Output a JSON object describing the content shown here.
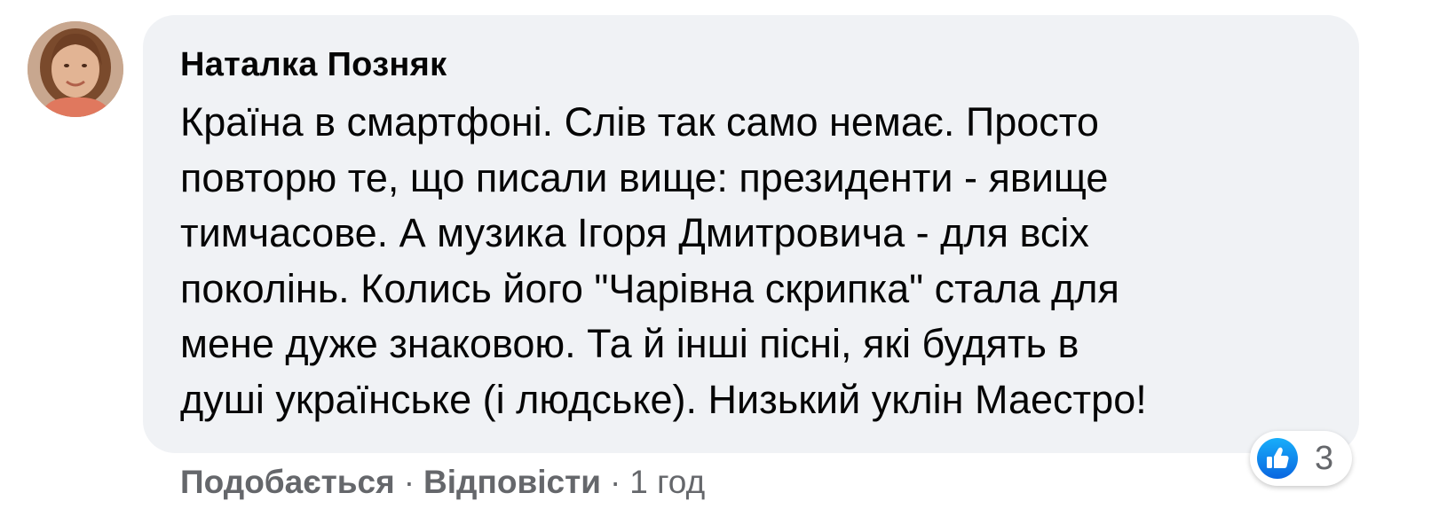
{
  "comment": {
    "author": "Наталка Позняк",
    "text_lines": [
      "Країна в смартфоні. Слів так само немає. Просто",
      "повторю те, що писали вище: президенти - явище",
      "тимчасове. А музика Ігоря Дмитровича - для всіх",
      "поколінь. Колись його \"Чарівна скрипка\" стала для",
      "мене дуже знаковою. Та й інші пісні, які будять в",
      "душі українське (і людське). Низький уклін Маестро!"
    ],
    "reaction": {
      "icon": "like-icon",
      "count": "3",
      "color": "#1877f2"
    }
  },
  "actions": {
    "like_label": "Подобається",
    "separator": "·",
    "reply_label": "Відповісти",
    "timestamp": "1 год"
  },
  "colors": {
    "bubble": "#f0f2f5",
    "text": "#050505",
    "secondary_text": "#65676b",
    "accent": "#1877f2"
  }
}
